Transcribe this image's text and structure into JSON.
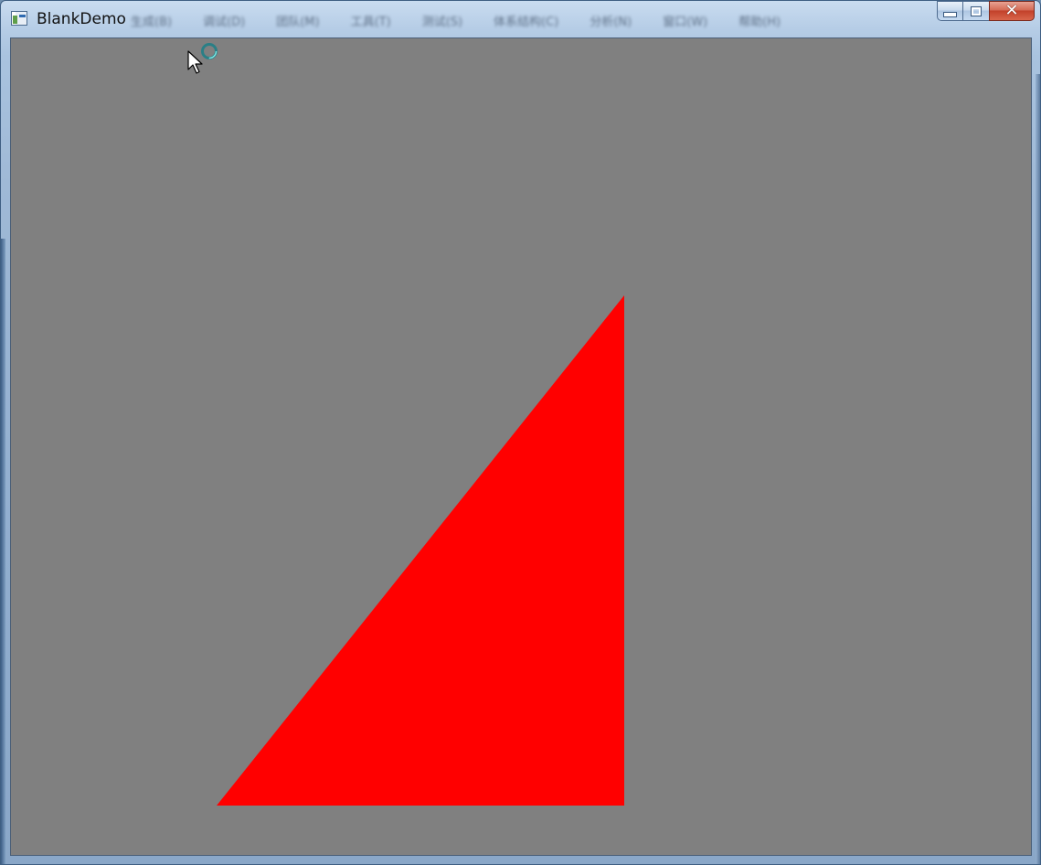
{
  "window": {
    "title": "BlankDemo",
    "icon": "application-icon",
    "menu_items": [
      "生成(B)",
      "调试(D)",
      "团队(M)",
      "工具(T)",
      "测试(S)",
      "体系结构(C)",
      "分析(N)",
      "窗口(W)",
      "帮助(H)"
    ],
    "caption_buttons": {
      "minimize": "minimize-icon",
      "maximize": "maximize-icon",
      "close": "close-icon"
    }
  },
  "canvas": {
    "background_color": "#808080",
    "shape": {
      "type": "triangle",
      "fill_color": "#FF0000"
    }
  },
  "cursor": {
    "icon": "busy-arrow-cursor-icon"
  }
}
